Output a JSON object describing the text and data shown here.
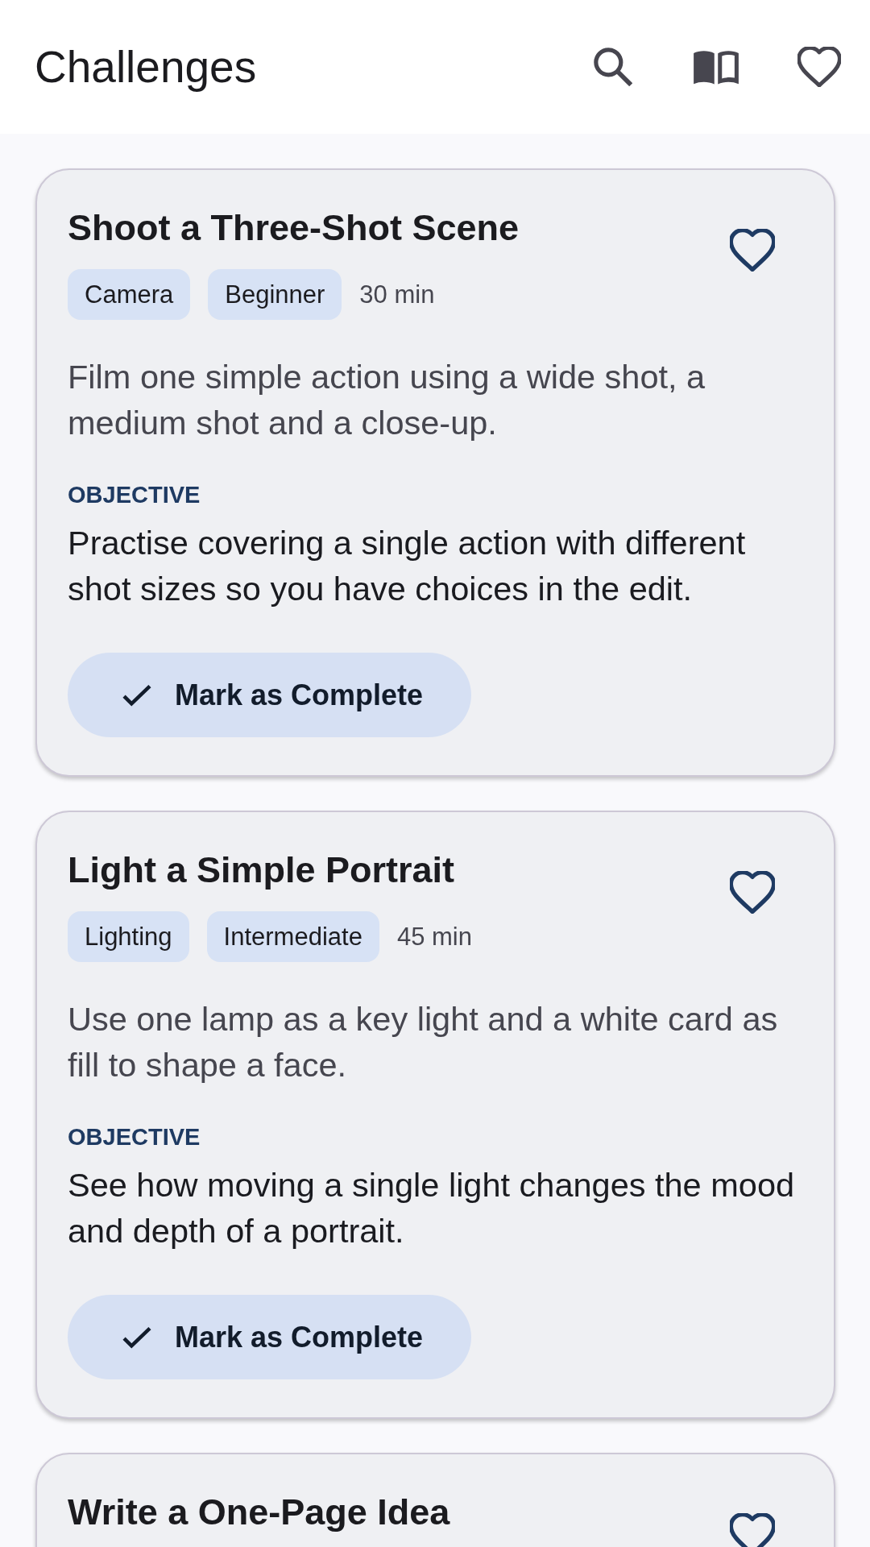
{
  "app_bar": {
    "title": "Challenges"
  },
  "challenges": [
    {
      "title": "Shoot a Three-Shot Scene",
      "favorite": false,
      "tags": [
        "Camera",
        "Beginner"
      ],
      "duration": "30 min",
      "description": "Film one simple action using a wide shot, a medium shot and a close-up.",
      "objective_label": "OBJECTIVE",
      "objective": "Practise covering a single action with different shot sizes so you have choices in the edit.",
      "button": "Mark as Complete"
    },
    {
      "title": "Light a Simple Portrait",
      "favorite": false,
      "tags": [
        "Lighting",
        "Intermediate"
      ],
      "duration": "45 min",
      "description": "Use one lamp as a key light and a white card as fill to shape a face.",
      "objective_label": "OBJECTIVE",
      "objective": "See how moving a single light changes the mood and depth of a portrait.",
      "button": "Mark as Complete"
    },
    {
      "title": "Write a One-Page Idea",
      "favorite": false
    }
  ]
}
